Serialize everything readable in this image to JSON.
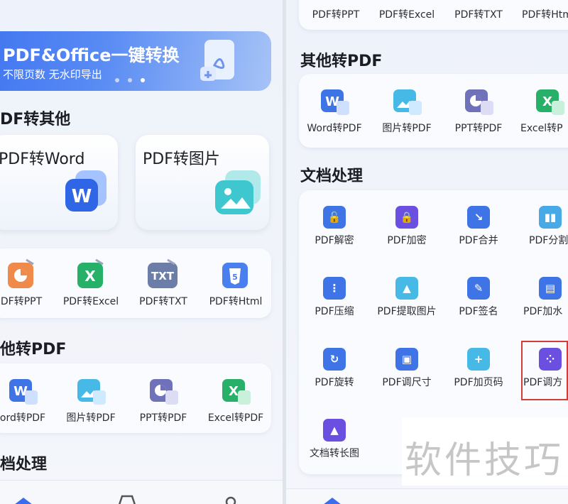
{
  "left": {
    "banner": {
      "title": "PDF&Office一键转换",
      "subtitle": "不限页数 无水印导出"
    },
    "section_pdf_to_other": "DF转其他",
    "big_cards": [
      {
        "label": "PDF转Word",
        "icon": "word-badge-icon"
      },
      {
        "label": "PDF转图片",
        "icon": "image-badge-icon"
      }
    ],
    "convert_tools": [
      {
        "label": "DF转PPT"
      },
      {
        "label": "PDF转Excel"
      },
      {
        "label": "PDF转TXT"
      },
      {
        "label": "PDF转Html"
      }
    ],
    "section_other_to_pdf": "他转PDF",
    "to_pdf_tools": [
      {
        "label": "ord转PDF"
      },
      {
        "label": "图片转PDF"
      },
      {
        "label": "PPT转PDF"
      },
      {
        "label": "Excel转PDF"
      }
    ],
    "section_doc": "档处理"
  },
  "right": {
    "top_row": [
      {
        "label": "PDF转PPT"
      },
      {
        "label": "PDF转Excel"
      },
      {
        "label": "PDF转TXT"
      },
      {
        "label": "PDF转Htm"
      }
    ],
    "section_other_to_pdf": "其他转PDF",
    "to_pdf_tools": [
      {
        "label": "Word转PDF"
      },
      {
        "label": "图片转PDF"
      },
      {
        "label": "PPT转PDF"
      },
      {
        "label": "Excel转P"
      }
    ],
    "section_doc": "文档处理",
    "doc_tools": [
      {
        "label": "PDF解密",
        "icon": "unlock-icon"
      },
      {
        "label": "PDF加密",
        "icon": "lock-icon"
      },
      {
        "label": "PDF合并",
        "icon": "merge-icon"
      },
      {
        "label": "PDF分割",
        "icon": "split-icon"
      },
      {
        "label": "PDF压缩",
        "icon": "zip-icon"
      },
      {
        "label": "PDF提取图片",
        "icon": "extract-image-icon"
      },
      {
        "label": "PDF签名",
        "icon": "signature-icon"
      },
      {
        "label": "PDF加水",
        "icon": "watermark-icon"
      },
      {
        "label": "PDF旋转",
        "icon": "rotate-icon"
      },
      {
        "label": "PDF调尺寸",
        "icon": "resize-icon"
      },
      {
        "label": "PDF加页码",
        "icon": "page-number-icon"
      },
      {
        "label": "PDF调方",
        "icon": "orientation-icon"
      },
      {
        "label": "文档转长图",
        "icon": "long-image-icon"
      }
    ],
    "watermark": "软件技巧"
  },
  "colors": {
    "accent": "#3a6df0",
    "highlight_box": "#d43b3b",
    "icon_blue": "#3f74e6",
    "icon_purple": "#6a4fe0"
  }
}
